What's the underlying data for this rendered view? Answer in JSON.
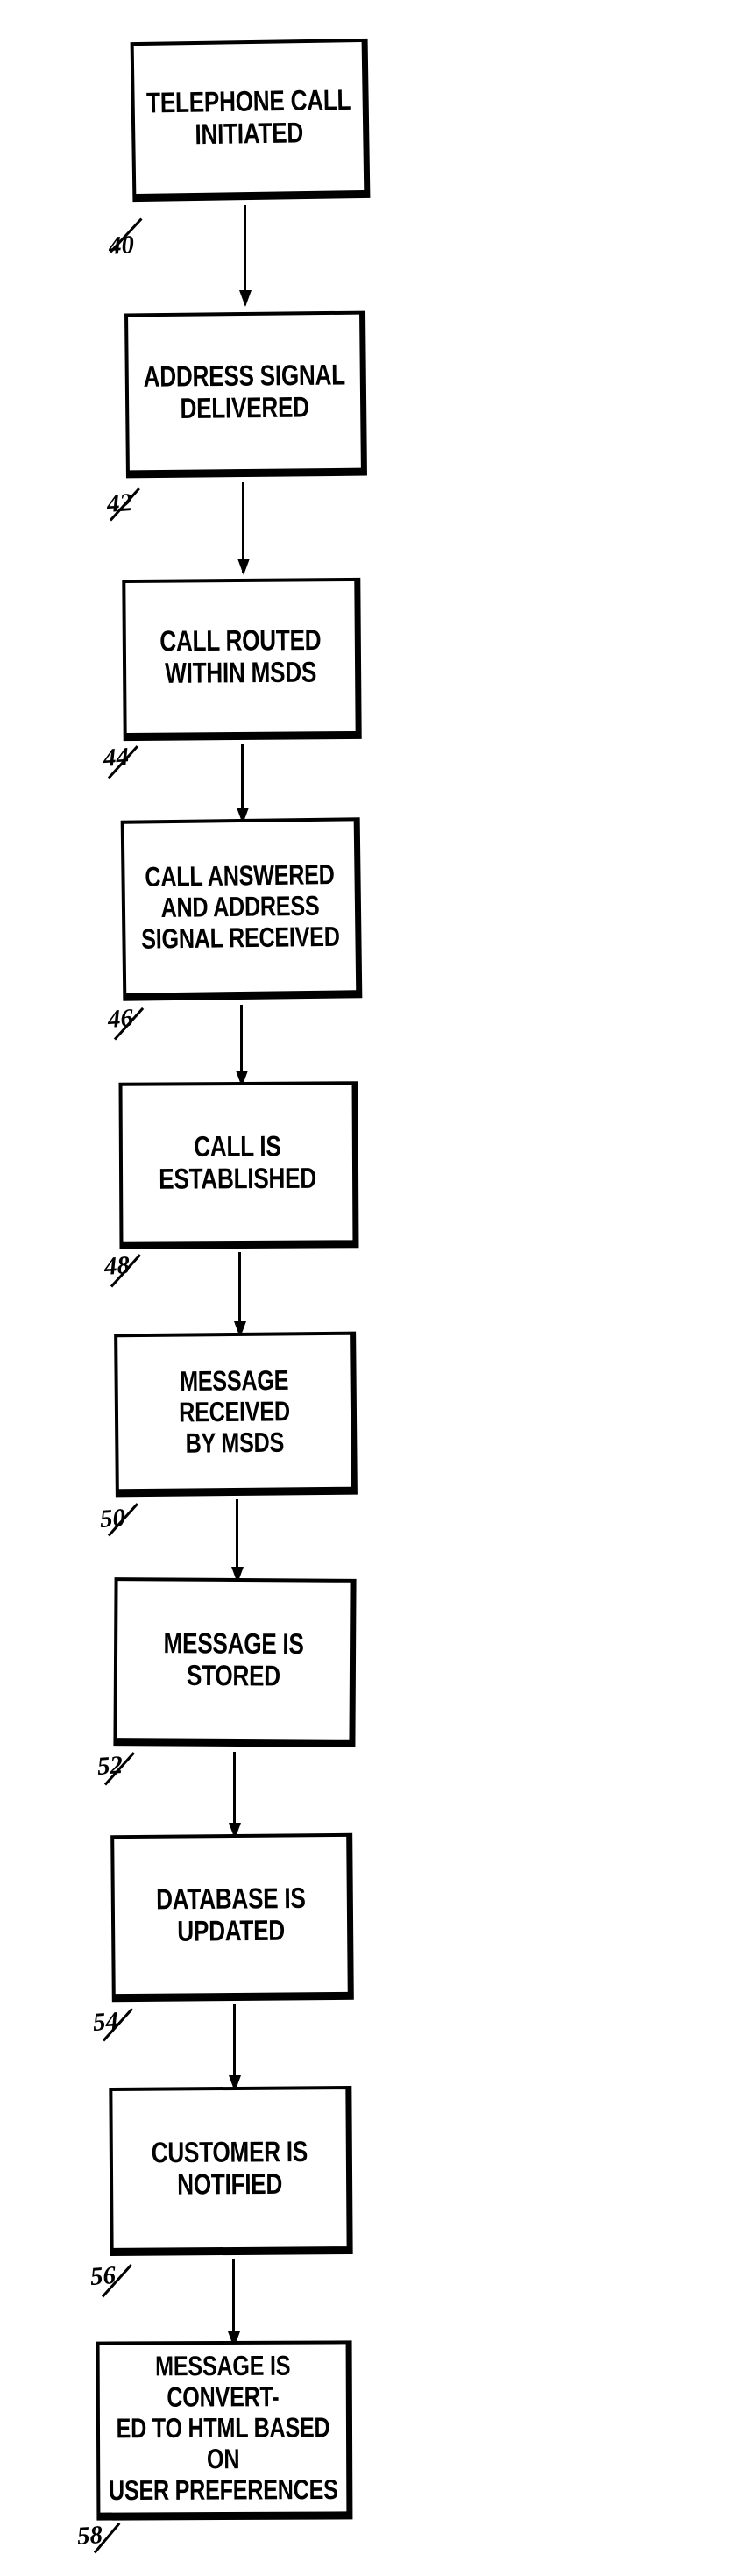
{
  "figure": {
    "kind": "patent-flowchart",
    "orientation": "vertical",
    "ink_color": "#000000",
    "paper_color": "#ffffff",
    "nodes": [
      {
        "ref": "40",
        "text": "TELEPHONE CALL\nINITIATED",
        "lines": [
          "TELEPHONE CALL",
          "INITIATED"
        ]
      },
      {
        "ref": "42",
        "text": "ADDRESS SIGNAL\nDELIVERED",
        "lines": [
          "ADDRESS SIGNAL",
          "DELIVERED"
        ]
      },
      {
        "ref": "44",
        "text": "CALL ROUTED\nWITHIN MSDS",
        "lines": [
          "CALL ROUTED",
          "WITHIN MSDS"
        ]
      },
      {
        "ref": "46",
        "text": "CALL ANSWERED\nAND ADDRESS\nSIGNAL RECEIVED",
        "lines": [
          "CALL ANSWERED",
          "AND ADDRESS",
          "SIGNAL RECEIVED"
        ]
      },
      {
        "ref": "48",
        "text": "CALL IS\nESTABLISHED",
        "lines": [
          "CALL IS",
          "ESTABLISHED"
        ]
      },
      {
        "ref": "50",
        "text": "MESSAGE RECEIVED\nBY MSDS",
        "lines": [
          "MESSAGE RECEIVED",
          "BY MSDS"
        ]
      },
      {
        "ref": "52",
        "text": "MESSAGE IS\nSTORED",
        "lines": [
          "MESSAGE IS",
          "STORED"
        ]
      },
      {
        "ref": "54",
        "text": "DATABASE IS\nUPDATED",
        "lines": [
          "DATABASE IS",
          "UPDATED"
        ]
      },
      {
        "ref": "56",
        "text": "CUSTOMER IS\nNOTIFIED",
        "lines": [
          "CUSTOMER IS",
          "NOTIFIED"
        ]
      },
      {
        "ref": "58",
        "text": "MESSAGE IS CONVERT-\nED TO HTML BASED ON\nUSER PREFERENCES",
        "lines": [
          "MESSAGE IS CONVERT-",
          "ED TO HTML BASED ON",
          "USER PREFERENCES"
        ]
      }
    ]
  }
}
